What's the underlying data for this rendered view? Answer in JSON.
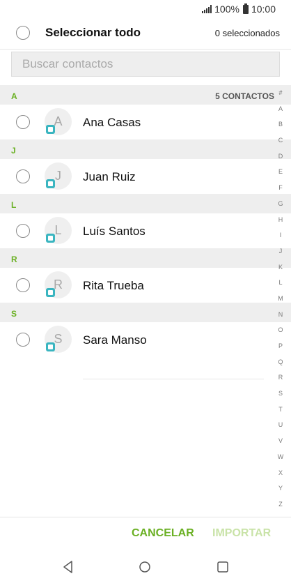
{
  "status": {
    "battery": "100%",
    "time": "10:00"
  },
  "header": {
    "select_all_label": "Seleccionar todo",
    "selected_count": "0 seleccionados"
  },
  "search": {
    "placeholder": "Buscar contactos"
  },
  "sections": [
    {
      "letter": "A",
      "total": "5 CONTACTOS",
      "contact": {
        "name": "Ana Casas",
        "initial": "A"
      }
    },
    {
      "letter": "J",
      "contact": {
        "name": "Juan Ruiz",
        "initial": "J"
      }
    },
    {
      "letter": "L",
      "contact": {
        "name": "Luís Santos",
        "initial": "L"
      }
    },
    {
      "letter": "R",
      "contact": {
        "name": "Rita Trueba",
        "initial": "R"
      }
    },
    {
      "letter": "S",
      "contact": {
        "name": "Sara Manso",
        "initial": "S"
      }
    }
  ],
  "index": [
    "#",
    "A",
    "B",
    "C",
    "D",
    "E",
    "F",
    "G",
    "H",
    "I",
    "J",
    "K",
    "L",
    "M",
    "N",
    "O",
    "P",
    "Q",
    "R",
    "S",
    "T",
    "U",
    "V",
    "W",
    "X",
    "Y",
    "Z"
  ],
  "actions": {
    "cancel": "CANCELAR",
    "import": "IMPORTAR"
  },
  "colors": {
    "accent": "#6ab023",
    "accent_disabled": "#c9e3a8",
    "account_badge": "#3ab5c0"
  },
  "icons": {
    "signal": "signal-icon",
    "battery": "battery-icon",
    "back": "back-icon",
    "home": "home-icon",
    "recents": "recents-icon"
  }
}
